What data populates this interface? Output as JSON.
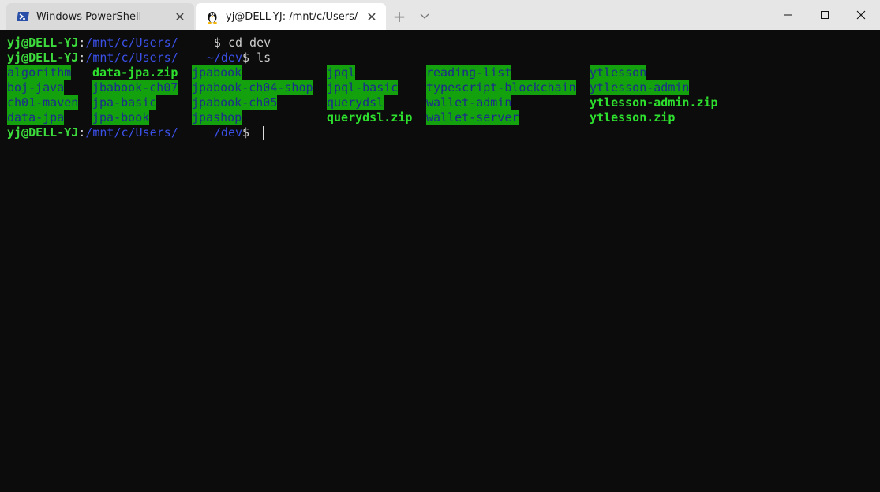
{
  "tabs": [
    {
      "title": "Windows PowerShell",
      "icon": "powershell-icon",
      "active": false
    },
    {
      "title": "yj@DELL-YJ: /mnt/c/Users/",
      "icon": "linux-penguin-icon",
      "active": true
    }
  ],
  "titlebar": {
    "new_tab": "+",
    "close_glyph": "✕"
  },
  "terminal": {
    "lines": [
      {
        "user": "yj@DELL-YJ",
        "sep": ":",
        "path": "/mnt/c/Users/",
        "rest": "     $ cd dev"
      },
      {
        "user": "yj@DELL-YJ",
        "sep": ":",
        "path": "/mnt/c/Users/    ~/dev",
        "rest": "$ ls"
      },
      {
        "user": "yj@DELL-YJ",
        "sep": ":",
        "path": "/mnt/c/Users/     /dev",
        "rest": "$ "
      }
    ],
    "ls_columns": [
      [
        "algorithm",
        "boj-java",
        "ch01-maven",
        "data-jpa"
      ],
      [
        "data-jpa.zip",
        "jbabook-ch07",
        "jpa-basic",
        "jpa-book"
      ],
      [
        "jpabook",
        "jpabook-ch04-shop",
        "jpabook-ch05",
        "jpashop"
      ],
      [
        "jpql",
        "jpql-basic",
        "querydsl",
        "querydsl.zip"
      ],
      [
        "reading-list",
        "typescript-blockchain",
        "wallet-admin",
        "wallet-server"
      ],
      [
        "ytlesson",
        "ytlesson-admin",
        "ytlesson-admin.zip",
        "ytlesson.zip"
      ]
    ]
  },
  "colors": {
    "dir_bg": "#13a10e",
    "dir_fg": "#1c2c8c",
    "zip_fg": "#2ee02e",
    "user_fg": "#3cdc3c",
    "path_fg": "#3b50e8"
  }
}
